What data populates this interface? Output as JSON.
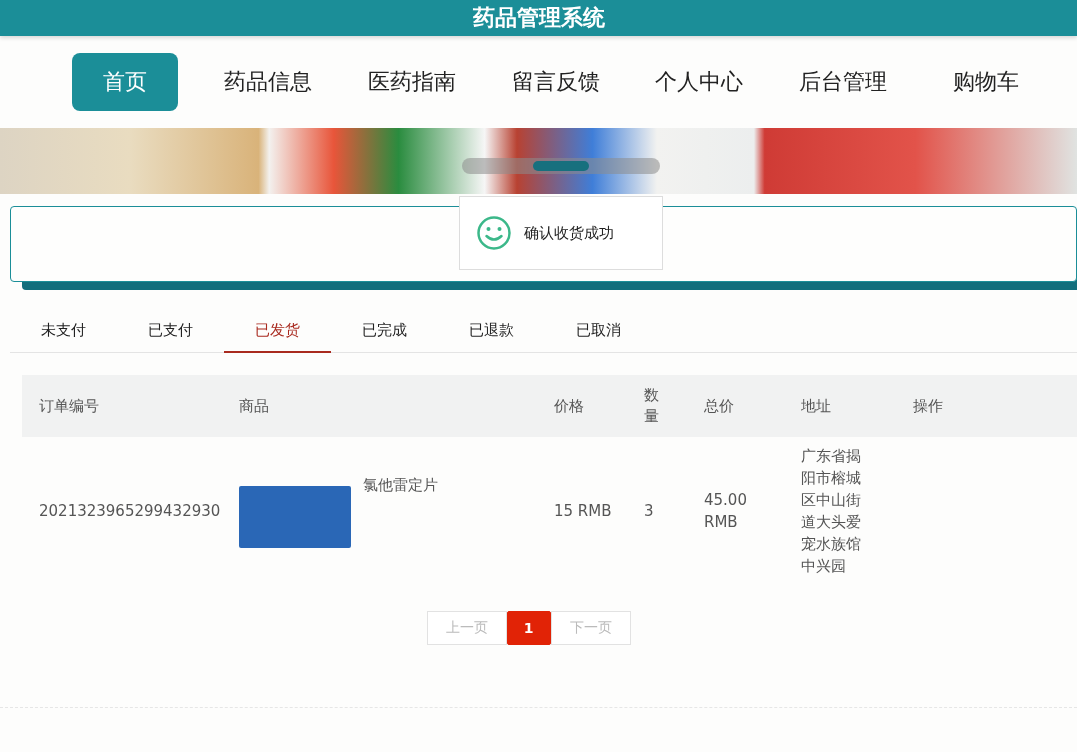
{
  "header": {
    "title": "药品管理系统"
  },
  "nav": [
    {
      "label": "首页",
      "selected": true
    },
    {
      "label": "药品信息",
      "selected": false
    },
    {
      "label": "医药指南",
      "selected": false
    },
    {
      "label": "留言反馈",
      "selected": false
    },
    {
      "label": "个人中心",
      "selected": false
    },
    {
      "label": "后台管理",
      "selected": false
    },
    {
      "label": "购物车",
      "selected": false
    }
  ],
  "toast": {
    "message": "确认收货成功"
  },
  "order_tabs": [
    {
      "label": "未支付",
      "selected": false
    },
    {
      "label": "已支付",
      "selected": false
    },
    {
      "label": "已发货",
      "selected": true
    },
    {
      "label": "已完成",
      "selected": false
    },
    {
      "label": "已退款",
      "selected": false
    },
    {
      "label": "已取消",
      "selected": false
    }
  ],
  "table": {
    "columns": [
      "订单编号",
      "商品",
      "价格",
      "数量",
      "总价",
      "地址",
      "操作"
    ],
    "rows": [
      {
        "order_no": "2021323965299432930",
        "product": "氯他雷定片",
        "price": "15 RMB",
        "quantity": "3",
        "total": "45.00 RMB",
        "address": "广东省揭阳市榕城区中山街道大头爱宠水族馆中兴园"
      }
    ]
  },
  "pagination": {
    "prev": "上一页",
    "pages": [
      {
        "label": "1",
        "selected": true
      }
    ],
    "next": "下一页"
  }
}
